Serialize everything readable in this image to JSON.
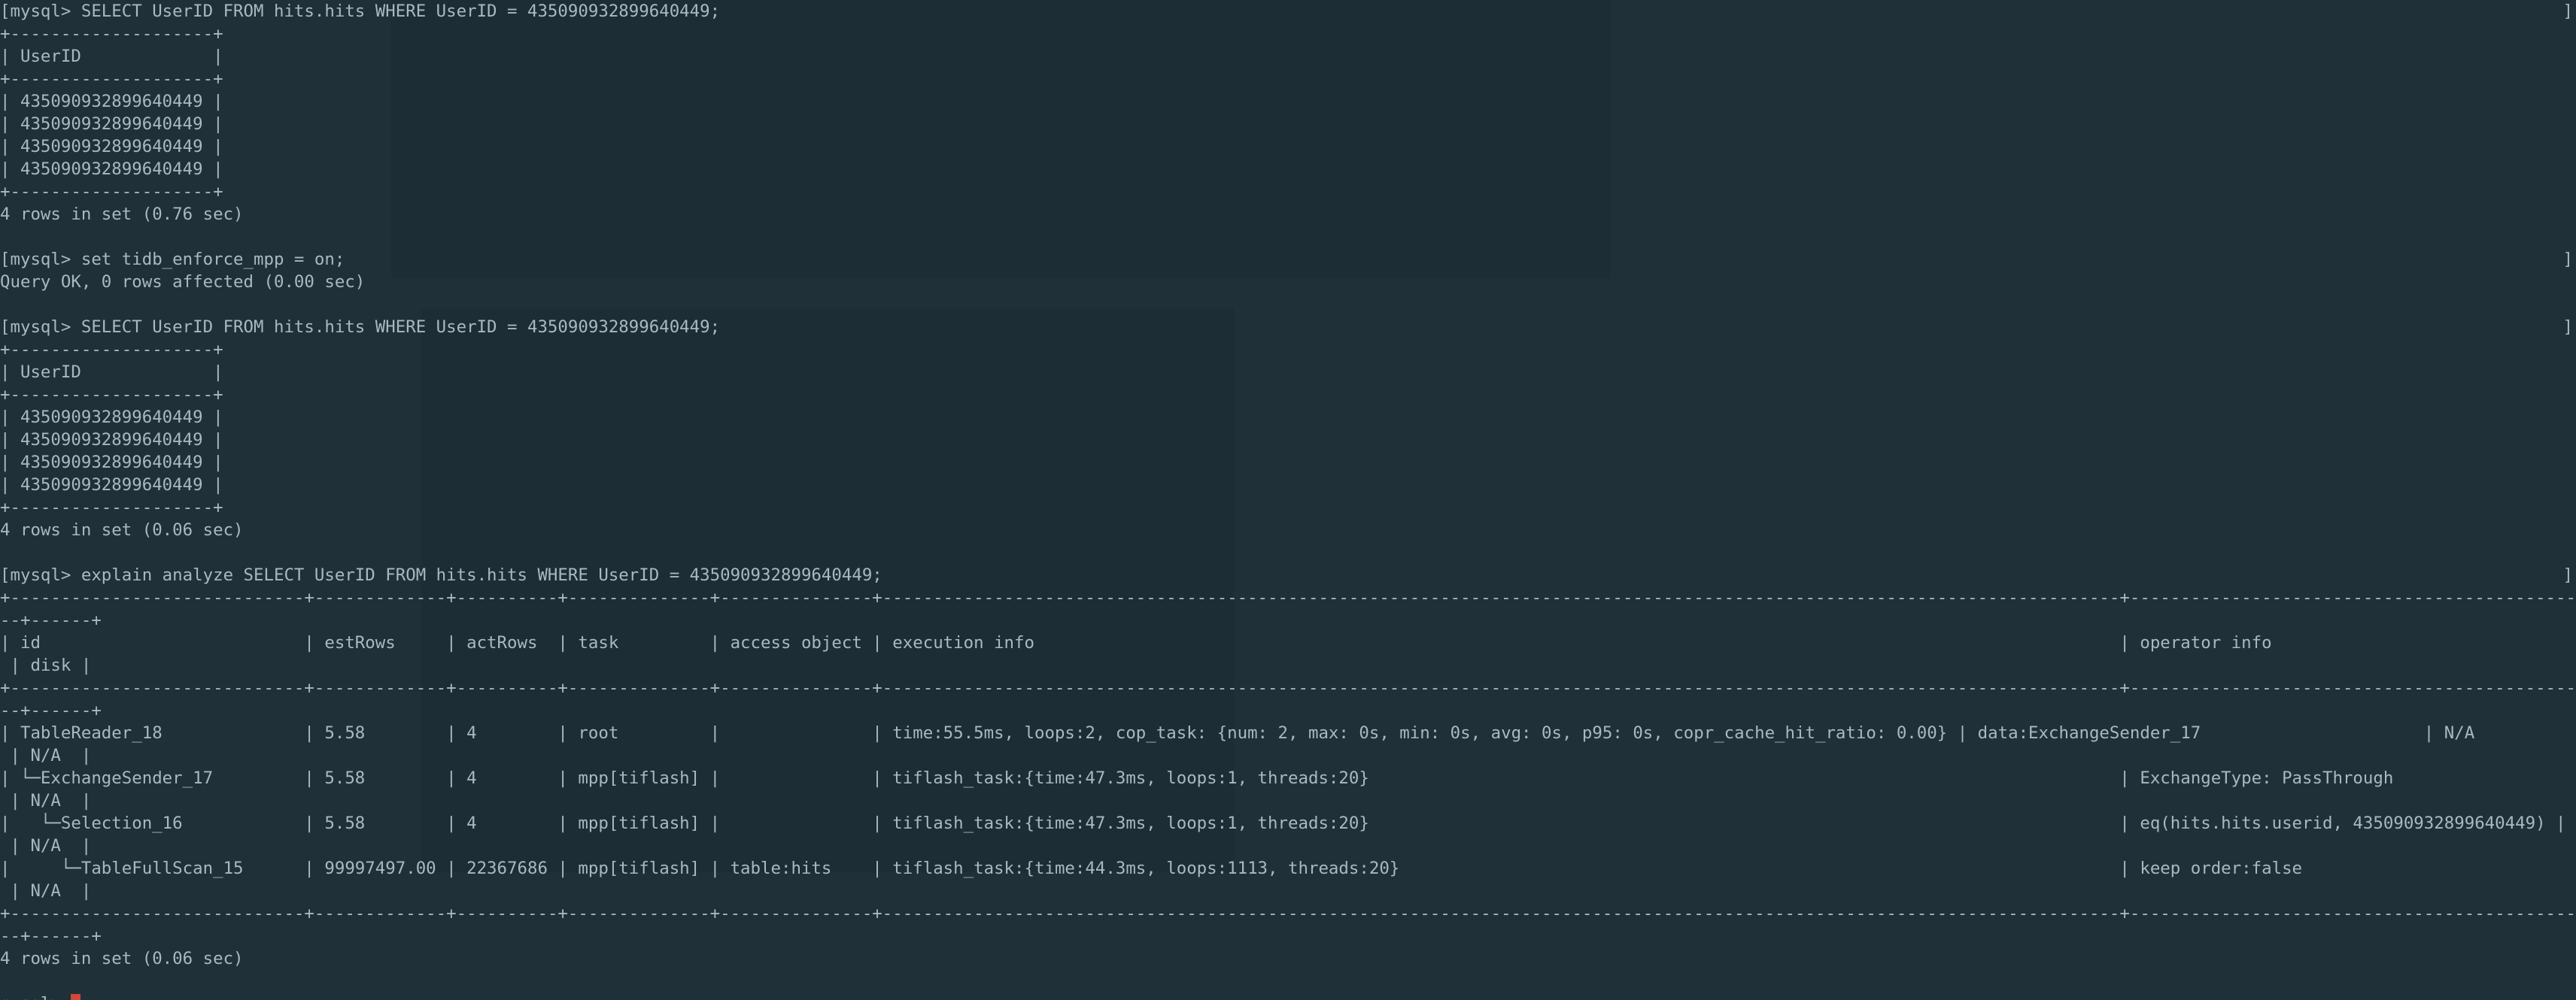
{
  "terminal": {
    "lines": [
      "[mysql> SELECT UserID FROM hits.hits WHERE UserID = 435090932899640449;",
      "+--------------------+",
      "| UserID             |",
      "+--------------------+",
      "| 435090932899640449 |",
      "| 435090932899640449 |",
      "| 435090932899640449 |",
      "| 435090932899640449 |",
      "+--------------------+",
      "4 rows in set (0.76 sec)",
      "",
      "[mysql> set tidb_enforce_mpp = on;",
      "Query OK, 0 rows affected (0.00 sec)",
      "",
      "[mysql> SELECT UserID FROM hits.hits WHERE UserID = 435090932899640449;",
      "+--------------------+",
      "| UserID             |",
      "+--------------------+",
      "| 435090932899640449 |",
      "| 435090932899640449 |",
      "| 435090932899640449 |",
      "| 435090932899640449 |",
      "+--------------------+",
      "4 rows in set (0.06 sec)",
      "",
      "[mysql> explain analyze SELECT UserID FROM hits.hits WHERE UserID = 435090932899640449;",
      "+-----------------------------+-------------+----------+--------------+---------------+--------------------------------------------------------------------------------------------------------------------------+---------------------------------------------+--------+",
      "--+------+",
      "| id                          | estRows     | actRows  | task         | access object | execution info                                                                                                           | operator info                               | memory",
      " | disk |",
      "+-----------------------------+-------------+----------+--------------+---------------+--------------------------------------------------------------------------------------------------------------------------+---------------------------------------------+--------+",
      "--+------+",
      "| TableReader_18              | 5.58        | 4        | root         |               | time:55.5ms, loops:2, cop_task: {num: 2, max: 0s, min: 0s, avg: 0s, p95: 0s, copr_cache_hit_ratio: 0.00} | data:ExchangeSender_17                      | N/A",
      " | N/A  |",
      "| └─ExchangeSender_17         | 5.58        | 4        | mpp[tiflash] |               | tiflash_task:{time:47.3ms, loops:1, threads:20}                                                                          | ExchangeType: PassThrough                   | N/A",
      " | N/A  |",
      "|   └─Selection_16            | 5.58        | 4        | mpp[tiflash] |               | tiflash_task:{time:47.3ms, loops:1, threads:20}                                                                          | eq(hits.hits.userid, 435090932899640449) | N/A",
      " | N/A  |",
      "|     └─TableFullScan_15      | 99997497.00 | 22367686 | mpp[tiflash] | table:hits    | tiflash_task:{time:44.3ms, loops:1113, threads:20}                                                                       | keep order:false                            | N/A",
      " | N/A  |",
      "+-----------------------------+-------------+----------+--------------+---------------+--------------------------------------------------------------------------------------------------------------------------+---------------------------------------------+--------+",
      "--+------+",
      "4 rows in set (0.06 sec)",
      "",
      "mysql> "
    ],
    "right_bracket": "]"
  },
  "colors": {
    "background": "#1f3039",
    "text": "#a9b9c0",
    "cursor": "#d0483a"
  }
}
